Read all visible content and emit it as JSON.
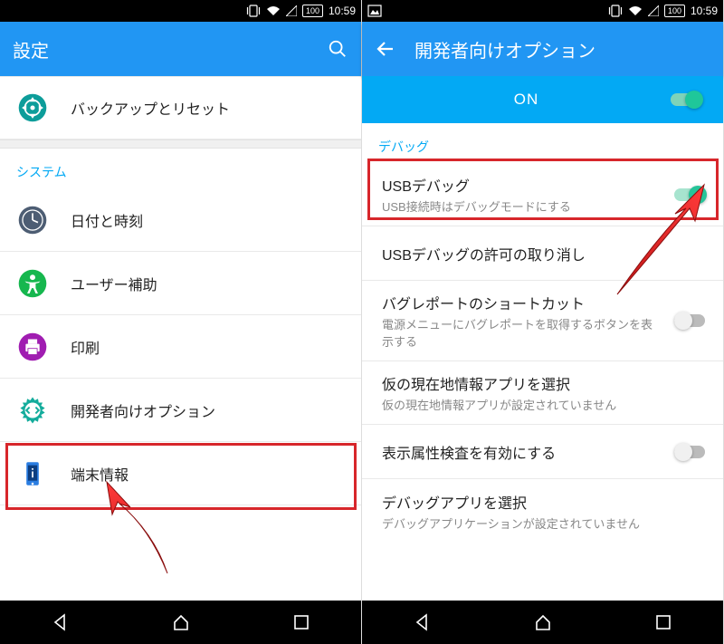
{
  "statusbar": {
    "battery": "100",
    "time": "10:59"
  },
  "left": {
    "title": "設定",
    "items": {
      "backup": "バックアップとリセット",
      "section_system": "システム",
      "datetime": "日付と時刻",
      "accessibility": "ユーザー補助",
      "print": "印刷",
      "devoptions": "開発者向けオプション",
      "about": "端末情報"
    }
  },
  "right": {
    "title": "開発者向けオプション",
    "on_label": "ON",
    "section_debug": "デバッグ",
    "items": {
      "usb_debug": {
        "t": "USBデバッグ",
        "s": "USB接続時はデバッグモードにする"
      },
      "revoke": {
        "t": "USBデバッグの許可の取り消し"
      },
      "bugshortcut": {
        "t": "バグレポートのショートカット",
        "s": "電源メニューにバグレポートを取得するボタンを表示する"
      },
      "mocklocation": {
        "t": "仮の現在地情報アプリを選択",
        "s": "仮の現在地情報アプリが設定されていません"
      },
      "viewattr": {
        "t": "表示属性検査を有効にする"
      },
      "debugapp": {
        "t": "デバッグアプリを選択",
        "s": "デバッグアプリケーションが設定されていません"
      }
    }
  }
}
